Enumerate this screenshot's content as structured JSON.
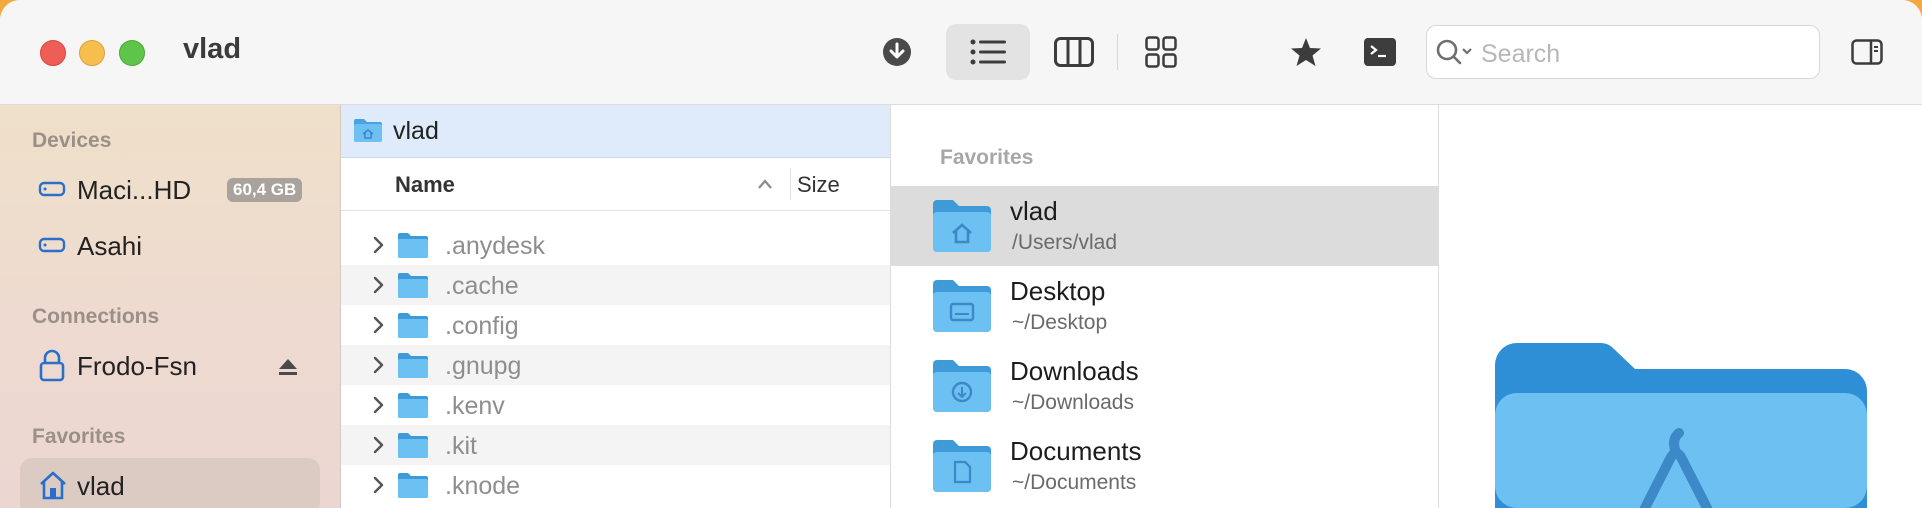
{
  "window": {
    "title": "vlad"
  },
  "toolbar": {
    "search_placeholder": "Search",
    "icons": [
      "download-icon",
      "list-view-icon",
      "column-view-icon",
      "grid-view-icon",
      "star-icon",
      "terminal-icon",
      "search-icon",
      "sidebar-toggle-icon"
    ]
  },
  "sidebar": {
    "devices_header": "Devices",
    "devices": [
      {
        "label": "Maci...HD",
        "badge": "60,4 GB"
      },
      {
        "label": "Asahi"
      }
    ],
    "connections_header": "Connections",
    "connections": [
      {
        "label": "Frodo-Fsn"
      }
    ],
    "favorites_header": "Favorites",
    "favorites": [
      {
        "label": "vlad",
        "selected": true
      }
    ]
  },
  "column1": {
    "path_label": "vlad",
    "header_name": "Name",
    "header_size": "Size",
    "rows": [
      {
        "name": ".anydesk"
      },
      {
        "name": ".cache"
      },
      {
        "name": ".config"
      },
      {
        "name": ".gnupg"
      },
      {
        "name": ".kenv"
      },
      {
        "name": ".kit"
      },
      {
        "name": ".knode"
      }
    ]
  },
  "column2": {
    "header": "Favorites",
    "items": [
      {
        "title": "vlad",
        "path": "/Users/vlad",
        "icon": "home-folder-icon",
        "selected": true
      },
      {
        "title": "Desktop",
        "path": "~/Desktop",
        "icon": "desktop-folder-icon"
      },
      {
        "title": "Downloads",
        "path": "~/Downloads",
        "icon": "downloads-folder-icon"
      },
      {
        "title": "Documents",
        "path": "~/Documents",
        "icon": "documents-folder-icon"
      }
    ]
  },
  "colors": {
    "folder_blue": "#5bb6ec",
    "selection_blue": "#dfeafa",
    "sidebar_selected": "#dccbc2"
  }
}
